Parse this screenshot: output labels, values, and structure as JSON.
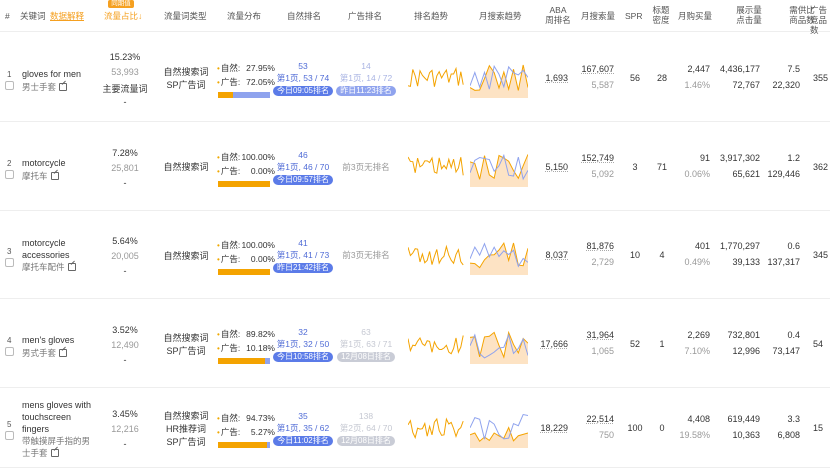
{
  "header": {
    "idx": "#",
    "keyword": "关键词",
    "data_explain": "数据解释",
    "badge": "同期值",
    "traffic_share": "流量占比",
    "sort_arrow": "↓",
    "traffic_type": "流量词类型",
    "traffic_dist": "流量分布",
    "organic_rank": "自然排名",
    "ad_rank": "广告排名",
    "rank_trend": "排名趋势",
    "monthly_trend": "月搜索趋势",
    "aba_rank_l1": "ABA",
    "aba_rank_l2": "周排名",
    "monthly_search": "月搜索量",
    "spr": "SPR",
    "title_density_l1": "标题",
    "title_density_l2": "密度",
    "monthly_purchase": "月购买量",
    "impressions_l1": "展示量",
    "impressions_l2": "点击量",
    "supply_ratio_l1": "需供比",
    "supply_ratio_l2": "商品数",
    "ad_products_l1": "广告",
    "ad_products_l2": "竞品数"
  },
  "labels": {
    "organic": "自然:",
    "ad": "广告:"
  },
  "colors": {
    "accent_orange": "#f4a300",
    "accent_blue": "#5b7be8",
    "light_blue": "#8fa3ee"
  },
  "rows": [
    {
      "idx": "1",
      "kw_en": "gloves for men",
      "kw_cn": "男士手套",
      "share": "15.23%",
      "share_count": "53,993",
      "main_tag": "主要流量词",
      "dash": "-",
      "types": [
        "自然搜索词",
        "SP广告词"
      ],
      "organic_pct": "27.95%",
      "ad_pct": "72.05%",
      "organic_fill": 0.28,
      "ad_fill": 0.72,
      "org_rank": "53",
      "org_page": "第1页, 53 / 74",
      "org_pill": "今日09:05排名",
      "ad_rank": "14",
      "ad_page": "第1页, 14 / 72",
      "ad_pill": "昨日11:23排名",
      "ad_pill_style": "blue",
      "aba": "1,693",
      "search": "167,607",
      "search2": "5,587",
      "spr": "56",
      "density": "28",
      "purchase": "2,447",
      "purchase_pct": "1.46%",
      "impr": "4,436,177",
      "clicks": "72,767",
      "ratio": "7.5",
      "products": "22,320",
      "adcomp": "355"
    },
    {
      "idx": "2",
      "kw_en": "motorcycle",
      "kw_cn": "摩托车",
      "share": "7.28%",
      "share_count": "25,801",
      "main_tag": "",
      "dash": "-",
      "types": [
        "自然搜索词"
      ],
      "organic_pct": "100.00%",
      "ad_pct": "0.00%",
      "organic_fill": 1.0,
      "ad_fill": 0,
      "org_rank": "46",
      "org_page": "第1页, 46 / 70",
      "org_pill": "今日09:57排名",
      "ad_rank": "",
      "ad_page": "前3页无排名",
      "ad_pill": "",
      "ad_pill_style": "",
      "aba": "5,150",
      "search": "152,749",
      "search2": "5,092",
      "spr": "3",
      "density": "71",
      "purchase": "91",
      "purchase_pct": "0.06%",
      "impr": "3,917,302",
      "clicks": "65,621",
      "ratio": "1.2",
      "products": "129,446",
      "adcomp": "362"
    },
    {
      "idx": "3",
      "kw_en": "motorcycle accessories",
      "kw_cn": "摩托车配件",
      "share": "5.64%",
      "share_count": "20,005",
      "main_tag": "",
      "dash": "-",
      "types": [
        "自然搜索词"
      ],
      "organic_pct": "100.00%",
      "ad_pct": "0.00%",
      "organic_fill": 1.0,
      "ad_fill": 0,
      "org_rank": "41",
      "org_page": "第1页, 41 / 73",
      "org_pill": "昨日21:42排名",
      "ad_rank": "",
      "ad_page": "前3页无排名",
      "ad_pill": "",
      "ad_pill_style": "",
      "aba": "8,037",
      "search": "81,876",
      "search2": "2,729",
      "spr": "10",
      "density": "4",
      "purchase": "401",
      "purchase_pct": "0.49%",
      "impr": "1,770,297",
      "clicks": "39,133",
      "ratio": "0.6",
      "products": "137,317",
      "adcomp": "345"
    },
    {
      "idx": "4",
      "kw_en": "men's gloves",
      "kw_cn": "男式手套",
      "share": "3.52%",
      "share_count": "12,490",
      "main_tag": "",
      "dash": "-",
      "types": [
        "自然搜索词",
        "SP广告词"
      ],
      "organic_pct": "89.82%",
      "ad_pct": "10.18%",
      "organic_fill": 0.9,
      "ad_fill": 0.1,
      "org_rank": "32",
      "org_page": "第1页, 32 / 50",
      "org_pill": "今日10:58排名",
      "ad_rank": "63",
      "ad_page": "第1页, 63 / 71",
      "ad_pill": "12月08日排名",
      "ad_pill_style": "gray",
      "aba": "17,666",
      "search": "31,964",
      "search2": "1,065",
      "spr": "52",
      "density": "1",
      "purchase": "2,269",
      "purchase_pct": "7.10%",
      "impr": "732,801",
      "clicks": "12,996",
      "ratio": "0.4",
      "products": "73,147",
      "adcomp": "54"
    },
    {
      "idx": "5",
      "kw_en": "mens gloves with touchscreen fingers",
      "kw_cn": "带触摸屏手指的男士手套",
      "share": "3.45%",
      "share_count": "12,216",
      "main_tag": "",
      "dash": "-",
      "types": [
        "自然搜索词",
        "HR推荐词",
        "SP广告词"
      ],
      "organic_pct": "94.73%",
      "ad_pct": "5.27%",
      "organic_fill": 0.95,
      "ad_fill": 0.05,
      "org_rank": "35",
      "org_page": "第1页, 35 / 62",
      "org_pill": "今日11:02排名",
      "ad_rank": "138",
      "ad_page": "第2页, 64 / 70",
      "ad_pill": "12月08日排名",
      "ad_pill_style": "gray",
      "aba": "18,229",
      "search": "22,514",
      "search2": "750",
      "spr": "100",
      "density": "0",
      "purchase": "4,408",
      "purchase_pct": "19.58%",
      "impr": "619,449",
      "clicks": "10,363",
      "ratio": "3.3",
      "products": "6,808",
      "adcomp": "15"
    }
  ]
}
